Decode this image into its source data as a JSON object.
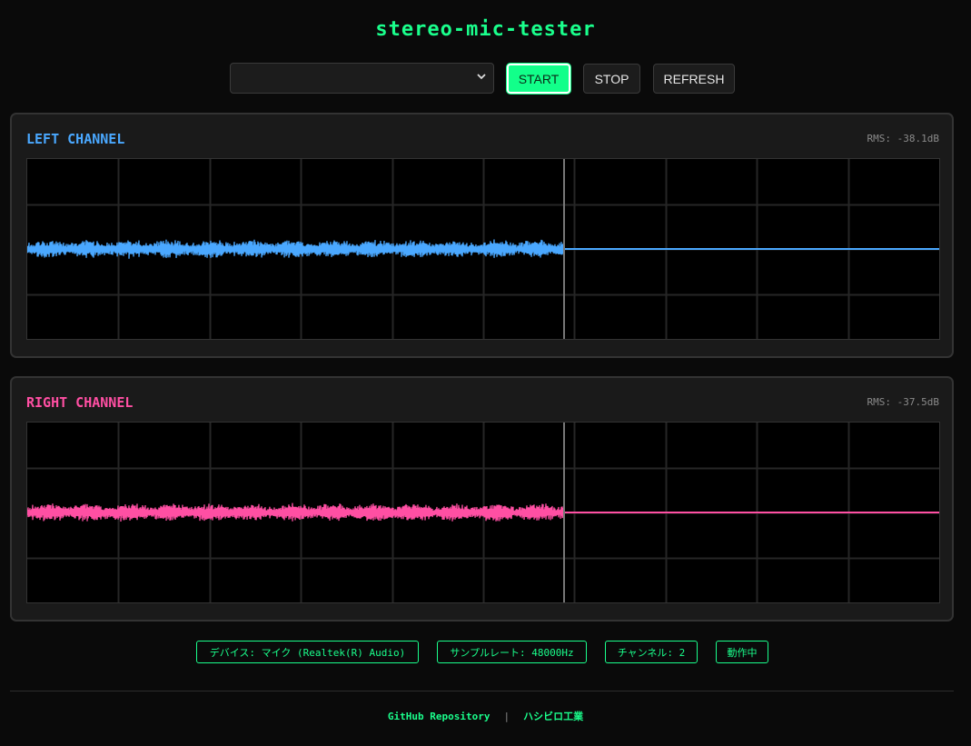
{
  "app": {
    "title": "stereo-mic-tester"
  },
  "controls": {
    "device_select_value": "",
    "start_label": "START",
    "stop_label": "STOP",
    "refresh_label": "REFRESH"
  },
  "channels": [
    {
      "label": "LEFT CHANNEL",
      "rms": "RMS: -38.1dB",
      "color": "#4aa8ff"
    },
    {
      "label": "RIGHT CHANNEL",
      "rms": "RMS: -37.5dB",
      "color": "#ff4fa3"
    }
  ],
  "status": {
    "device": "デバイス: マイク (Realtek(R) Audio)",
    "sample_rate": "サンプルレート: 48000Hz",
    "channels": "チャンネル: 2",
    "state": "動作中"
  },
  "footer": {
    "repo_link": "GitHub Repository",
    "separator": "|",
    "author_link": "ハシビロ工業"
  },
  "colors": {
    "accent": "#1aff8c",
    "background": "#0a0a0a",
    "panel": "#1a1a1a"
  }
}
